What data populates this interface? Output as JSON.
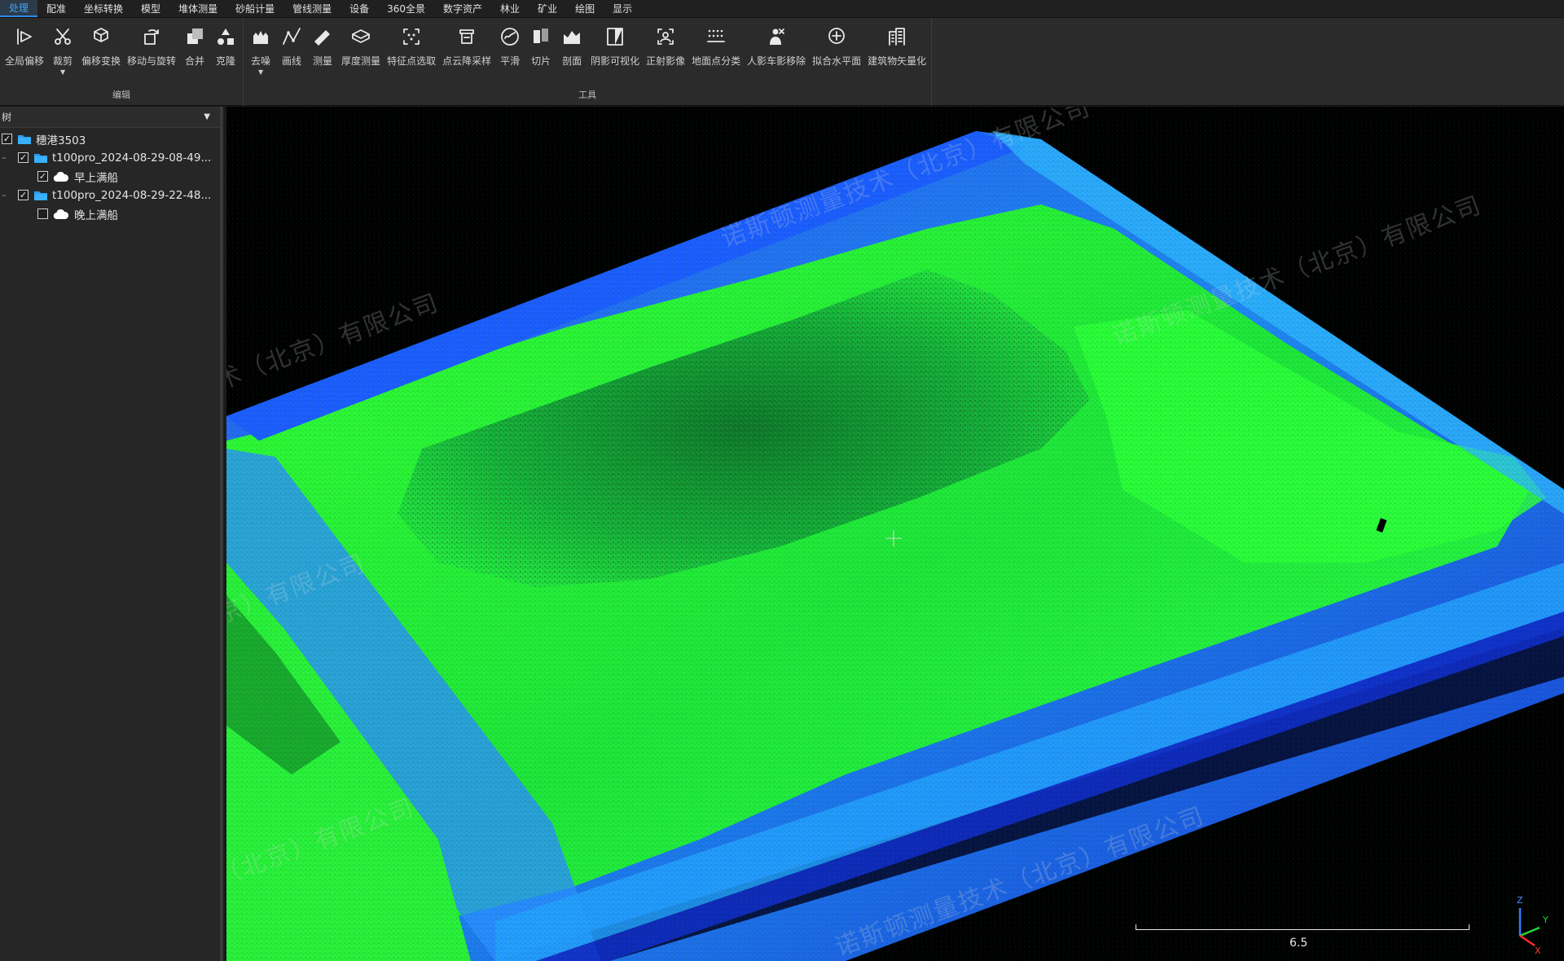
{
  "menu": [
    {
      "label": "处理",
      "active": true
    },
    {
      "label": "配准"
    },
    {
      "label": "坐标转换"
    },
    {
      "label": "模型"
    },
    {
      "label": "堆体测量"
    },
    {
      "label": "砂船计量"
    },
    {
      "label": "管线测量"
    },
    {
      "label": "设备"
    },
    {
      "label": "360全景"
    },
    {
      "label": "数字资产"
    },
    {
      "label": "林业"
    },
    {
      "label": "矿业"
    },
    {
      "label": "绘图"
    },
    {
      "label": "显示"
    }
  ],
  "ribbon": {
    "edit_group": {
      "label": "编辑",
      "tools": [
        {
          "label": "全局偏移",
          "icon": "global-offset-icon"
        },
        {
          "label": "裁剪",
          "icon": "scissors-icon",
          "dropdown": true
        },
        {
          "label": "偏移变换",
          "icon": "transform-icon"
        },
        {
          "label": "移动与旋转",
          "icon": "move-rotate-icon"
        },
        {
          "label": "合并",
          "icon": "merge-icon"
        },
        {
          "label": "克隆",
          "icon": "clone-icon"
        }
      ]
    },
    "tools_group": {
      "label": "工具",
      "tools": [
        {
          "label": "去噪",
          "icon": "denoise-icon",
          "dropdown": true
        },
        {
          "label": "画线",
          "icon": "polyline-icon"
        },
        {
          "label": "测量",
          "icon": "ruler-icon"
        },
        {
          "label": "厚度测量",
          "icon": "thickness-icon"
        },
        {
          "label": "特征点选取",
          "icon": "feature-point-icon"
        },
        {
          "label": "点云降采样",
          "icon": "downsample-icon"
        },
        {
          "label": "平滑",
          "icon": "smooth-icon"
        },
        {
          "label": "切片",
          "icon": "slice-icon"
        },
        {
          "label": "剖面",
          "icon": "profile-icon"
        },
        {
          "label": "阴影可视化",
          "icon": "shadow-icon"
        },
        {
          "label": "正射影像",
          "icon": "ortho-icon"
        },
        {
          "label": "地面点分类",
          "icon": "ground-classify-icon"
        },
        {
          "label": "人影车影移除",
          "icon": "person-remove-icon"
        },
        {
          "label": "拟合水平面",
          "icon": "fit-plane-icon"
        },
        {
          "label": "建筑物矢量化",
          "icon": "building-icon"
        }
      ]
    }
  },
  "tree": {
    "header": "树",
    "items": [
      {
        "label": "穗港3503",
        "level": 0,
        "checked": true,
        "type": "folder"
      },
      {
        "label": "t100pro_2024-08-29-08-49...",
        "level": 1,
        "checked": true,
        "type": "folder"
      },
      {
        "label": "早上满船",
        "level": 2,
        "checked": true,
        "type": "cloud"
      },
      {
        "label": "t100pro_2024-08-29-22-48...",
        "level": 1,
        "checked": true,
        "type": "folder"
      },
      {
        "label": "晚上满船",
        "level": 2,
        "checked": false,
        "type": "cloud"
      }
    ]
  },
  "viewport": {
    "watermark": "诺斯顿测量技术（北京）有限公司",
    "scale_value": "6.5",
    "axes": {
      "z": "Z",
      "y": "Y",
      "x": "X"
    },
    "colors": {
      "high": "#22ff22",
      "mid": "#16d9a0",
      "low": "#1a3fff",
      "background": "#000000"
    }
  }
}
